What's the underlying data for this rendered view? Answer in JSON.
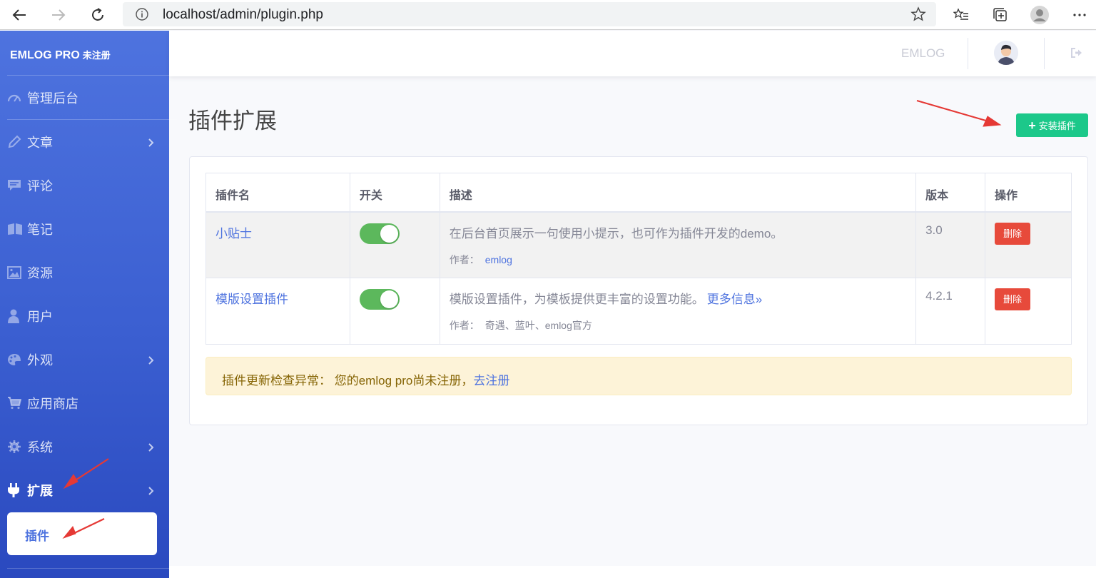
{
  "browser": {
    "url": "localhost/admin/plugin.php"
  },
  "sidebar": {
    "brand": "EMLOG PRO",
    "brand_sub": "未注册",
    "items": [
      {
        "label": "管理后台",
        "icon": "dashboard-icon"
      },
      {
        "label": "文章",
        "icon": "pencil-icon"
      },
      {
        "label": "评论",
        "icon": "comment-icon"
      },
      {
        "label": "笔记",
        "icon": "book-icon"
      },
      {
        "label": "资源",
        "icon": "image-icon"
      },
      {
        "label": "用户",
        "icon": "user-icon"
      },
      {
        "label": "外观",
        "icon": "palette-icon"
      },
      {
        "label": "应用商店",
        "icon": "cart-icon"
      },
      {
        "label": "系统",
        "icon": "gear-icon"
      },
      {
        "label": "扩展",
        "icon": "plug-icon"
      }
    ],
    "sub_item": "插件"
  },
  "topbar": {
    "site_name": "EMLOG"
  },
  "main": {
    "title": "插件扩展",
    "install_button": "安装插件",
    "table": {
      "headers": [
        "插件名",
        "开关",
        "描述",
        "版本",
        "操作"
      ],
      "rows": [
        {
          "name": "小贴士",
          "enabled": true,
          "description": "在后台首页展示一句使用小提示，也可作为插件开发的demo。",
          "author_label": "作者：",
          "author": "emlog",
          "version": "3.0",
          "action": "删除"
        },
        {
          "name": "模版设置插件",
          "enabled": true,
          "description": "模版设置插件，为模板提供更丰富的设置功能。",
          "more": "更多信息»",
          "author_label": "作者：",
          "author": "奇遇、蓝叶、emlog官方",
          "version": "4.2.1",
          "action": "删除"
        }
      ]
    },
    "alert": {
      "text": "插件更新检查异常： 您的emlog pro尚未注册，",
      "link": "去注册"
    }
  },
  "colors": {
    "sidebar": "#4e73df",
    "install_button": "#1cc88a",
    "delete_button": "#e74a3b",
    "toggle_on": "#5cb85c",
    "alert_bg": "#fdf3d8"
  }
}
